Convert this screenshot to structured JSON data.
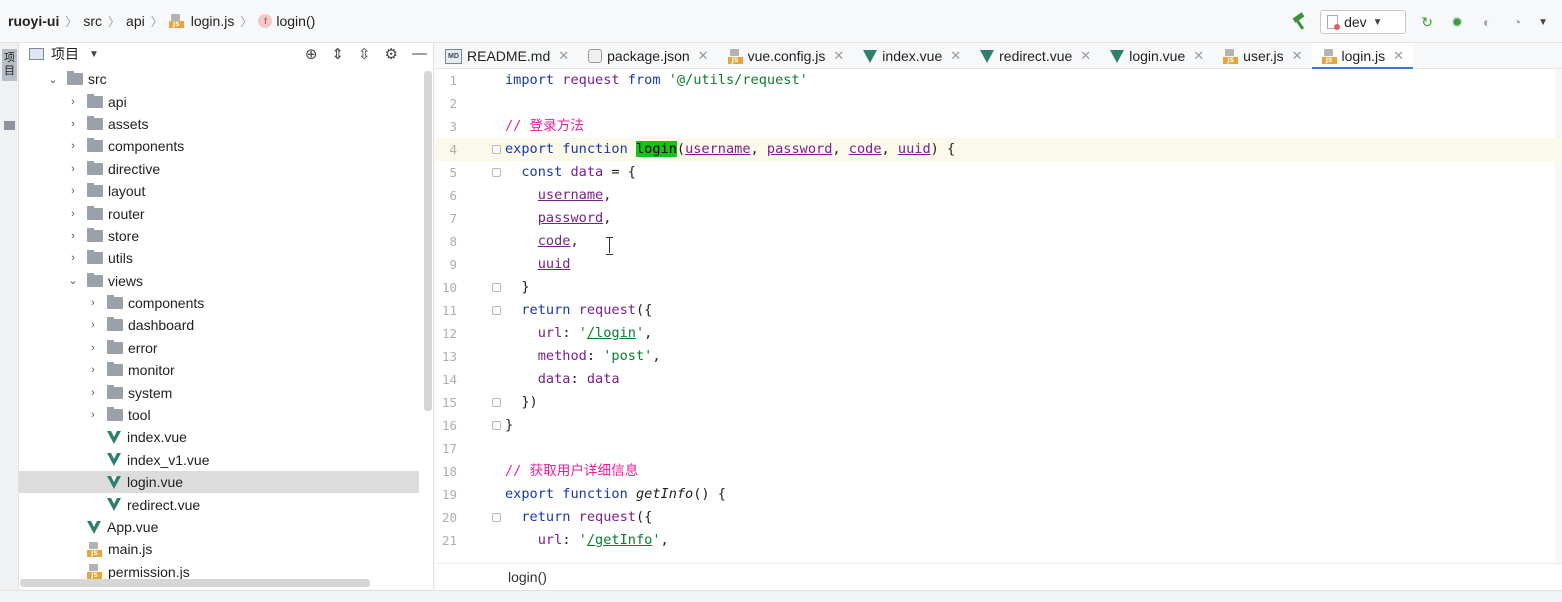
{
  "breadcrumb": {
    "project": "ruoyi-ui",
    "parts": [
      "src",
      "api"
    ],
    "file": "login.js",
    "function": "login()",
    "function_badge": "f"
  },
  "toolbar": {
    "branch": "dev"
  },
  "sidestrip": {
    "label": "项目"
  },
  "project_panel": {
    "title": "项目"
  },
  "tree": [
    {
      "label": "src",
      "type": "folder",
      "depth": 1,
      "expanded": true
    },
    {
      "label": "api",
      "type": "folder",
      "depth": 2,
      "expanded": false
    },
    {
      "label": "assets",
      "type": "folder",
      "depth": 2,
      "expanded": false
    },
    {
      "label": "components",
      "type": "folder",
      "depth": 2,
      "expanded": false
    },
    {
      "label": "directive",
      "type": "folder",
      "depth": 2,
      "expanded": false
    },
    {
      "label": "layout",
      "type": "folder",
      "depth": 2,
      "expanded": false
    },
    {
      "label": "router",
      "type": "folder",
      "depth": 2,
      "expanded": false
    },
    {
      "label": "store",
      "type": "folder",
      "depth": 2,
      "expanded": false
    },
    {
      "label": "utils",
      "type": "folder",
      "depth": 2,
      "expanded": false
    },
    {
      "label": "views",
      "type": "folder",
      "depth": 2,
      "expanded": true
    },
    {
      "label": "components",
      "type": "folder",
      "depth": 3,
      "expanded": false
    },
    {
      "label": "dashboard",
      "type": "folder",
      "depth": 3,
      "expanded": false
    },
    {
      "label": "error",
      "type": "folder",
      "depth": 3,
      "expanded": false
    },
    {
      "label": "monitor",
      "type": "folder",
      "depth": 3,
      "expanded": false
    },
    {
      "label": "system",
      "type": "folder",
      "depth": 3,
      "expanded": false
    },
    {
      "label": "tool",
      "type": "folder",
      "depth": 3,
      "expanded": false
    },
    {
      "label": "index.vue",
      "type": "vue",
      "depth": 3
    },
    {
      "label": "index_v1.vue",
      "type": "vue",
      "depth": 3
    },
    {
      "label": "login.vue",
      "type": "vue",
      "depth": 3,
      "selected": true
    },
    {
      "label": "redirect.vue",
      "type": "vue",
      "depth": 3
    },
    {
      "label": "App.vue",
      "type": "vue",
      "depth": 2
    },
    {
      "label": "main.js",
      "type": "js",
      "depth": 2
    },
    {
      "label": "permission.js",
      "type": "js",
      "depth": 2
    }
  ],
  "tabs": [
    {
      "label": "README.md",
      "icon": "md"
    },
    {
      "label": "package.json",
      "icon": "json"
    },
    {
      "label": "vue.config.js",
      "icon": "js"
    },
    {
      "label": "index.vue",
      "icon": "vue"
    },
    {
      "label": "redirect.vue",
      "icon": "vue"
    },
    {
      "label": "login.vue",
      "icon": "vue"
    },
    {
      "label": "user.js",
      "icon": "js"
    },
    {
      "label": "login.js",
      "icon": "js",
      "active": true
    }
  ],
  "code_lines": [
    {
      "n": "1",
      "tokens": [
        [
          "k",
          "import"
        ],
        [
          "",
          ""
        ],
        [
          "p",
          " request"
        ],
        [
          "k",
          " from"
        ],
        [
          "s",
          " '@/utils/request'"
        ]
      ]
    },
    {
      "n": "2",
      "tokens": []
    },
    {
      "n": "3",
      "tokens": [
        [
          "c",
          "// 登录方法"
        ]
      ]
    },
    {
      "n": "4",
      "highlight": true,
      "fold": true,
      "tokens": [
        [
          "k",
          "export function "
        ],
        [
          "fnhl",
          "login"
        ],
        [
          "",
          "("
        ],
        [
          "u",
          "username"
        ],
        [
          "",
          ", "
        ],
        [
          "u",
          "password"
        ],
        [
          "",
          ", "
        ],
        [
          "u",
          "code"
        ],
        [
          "",
          ", "
        ],
        [
          "u",
          "uuid"
        ],
        [
          "",
          ") {"
        ]
      ]
    },
    {
      "n": "5",
      "fold": true,
      "tokens": [
        [
          "",
          "  "
        ],
        [
          "k",
          "const"
        ],
        [
          "p",
          " data"
        ],
        [
          "",
          " = {"
        ]
      ]
    },
    {
      "n": "6",
      "tokens": [
        [
          "",
          "    "
        ],
        [
          "u",
          "username"
        ],
        [
          "",
          ","
        ]
      ]
    },
    {
      "n": "7",
      "tokens": [
        [
          "",
          "    "
        ],
        [
          "u",
          "password"
        ],
        [
          "",
          ","
        ]
      ]
    },
    {
      "n": "8",
      "tokens": [
        [
          "",
          "    "
        ],
        [
          "u",
          "code"
        ],
        [
          "",
          ","
        ]
      ]
    },
    {
      "n": "9",
      "tokens": [
        [
          "",
          "    "
        ],
        [
          "u",
          "uuid"
        ]
      ]
    },
    {
      "n": "10",
      "fold": true,
      "tokens": [
        [
          "",
          "  }"
        ]
      ]
    },
    {
      "n": "11",
      "fold": true,
      "tokens": [
        [
          "",
          "  "
        ],
        [
          "k",
          "return"
        ],
        [
          "p",
          " request"
        ],
        [
          "",
          "({"
        ]
      ]
    },
    {
      "n": "12",
      "tokens": [
        [
          "",
          "    "
        ],
        [
          "p",
          "url"
        ],
        [
          "",
          ": "
        ],
        [
          "s",
          "'"
        ],
        [
          "su",
          "/login"
        ],
        [
          "s",
          "'"
        ],
        [
          "",
          ","
        ]
      ]
    },
    {
      "n": "13",
      "tokens": [
        [
          "",
          "    "
        ],
        [
          "p",
          "method"
        ],
        [
          "",
          ": "
        ],
        [
          "s",
          "'post'"
        ],
        [
          "",
          ","
        ]
      ]
    },
    {
      "n": "14",
      "tokens": [
        [
          "",
          "    "
        ],
        [
          "p",
          "data"
        ],
        [
          "",
          ": "
        ],
        [
          "p",
          "data"
        ]
      ]
    },
    {
      "n": "15",
      "fold": true,
      "tokens": [
        [
          "",
          "  })"
        ]
      ]
    },
    {
      "n": "16",
      "fold": true,
      "tokens": [
        [
          "",
          "}"
        ]
      ]
    },
    {
      "n": "17",
      "tokens": []
    },
    {
      "n": "18",
      "tokens": [
        [
          "c",
          "// 获取用户详细信息"
        ]
      ]
    },
    {
      "n": "19",
      "tokens": [
        [
          "k",
          "export function "
        ],
        [
          "i",
          "getInfo"
        ],
        [
          "",
          "() {"
        ]
      ]
    },
    {
      "n": "20",
      "fold": true,
      "tokens": [
        [
          "",
          "  "
        ],
        [
          "k",
          "return"
        ],
        [
          "p",
          " request"
        ],
        [
          "",
          "({"
        ]
      ]
    },
    {
      "n": "21",
      "tokens": [
        [
          "",
          "    "
        ],
        [
          "p",
          "url"
        ],
        [
          "",
          ": "
        ],
        [
          "s",
          "'"
        ],
        [
          "su",
          "/getInfo"
        ],
        [
          "s",
          "'"
        ],
        [
          "",
          ","
        ]
      ]
    }
  ],
  "status": {
    "function": "login()"
  },
  "colors": {
    "keyword": "#1a38a8",
    "string": "#0a7e2e",
    "comment": "#e6219c",
    "identifier_highlight": "#14c414",
    "active_tab_underline": "#3c7ad8",
    "current_line": "#fbf9ea"
  }
}
